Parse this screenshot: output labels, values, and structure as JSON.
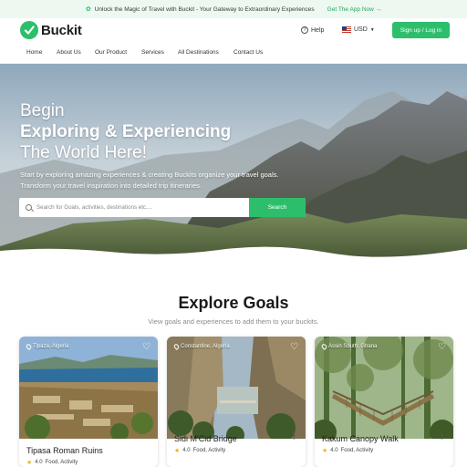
{
  "announcement": {
    "text": "Unlock the Magic of Travel with Buckit - Your Gateway to Extraordinary Experiences",
    "cta": "Get The App Now"
  },
  "header": {
    "brand": "Buckit",
    "help_label": "Help",
    "currency": "USD",
    "signup_label": "Sign up / Log in"
  },
  "nav": {
    "items": [
      "Home",
      "About Us",
      "Our Product",
      "Services",
      "All Destinations",
      "Contact Us"
    ]
  },
  "hero": {
    "line1": "Begin",
    "line2": "Exploring & Experiencing",
    "line3": "The World Here!",
    "subtitle": "Start by exploring amazing experiences & creating Buckits organize your travel goals. Transform your travel inspiration into detailed trip itineraries.",
    "search_placeholder": "Search for Goals, activities, destinations etc....",
    "search_button": "Search"
  },
  "explore": {
    "title": "Explore Goals",
    "subtitle": "View goals and experiences to add them to your buckits."
  },
  "cards": [
    {
      "location": "Tipaza, Algeria",
      "name": "Tipasa Roman Ruins",
      "rating": "4.0",
      "tags": "Food, Activity"
    },
    {
      "location": "Constantine, Algeria",
      "name": "Sidi M'Cid Bridge",
      "rating": "4.0",
      "tags": "Food, Activity"
    },
    {
      "location": "Assin South, Ghana",
      "name": "Kakum Canopy Walk",
      "rating": "4.0",
      "tags": "Food, Activity"
    }
  ],
  "colors": {
    "brand_green": "#2dbe6c",
    "star": "#f2b01e"
  }
}
